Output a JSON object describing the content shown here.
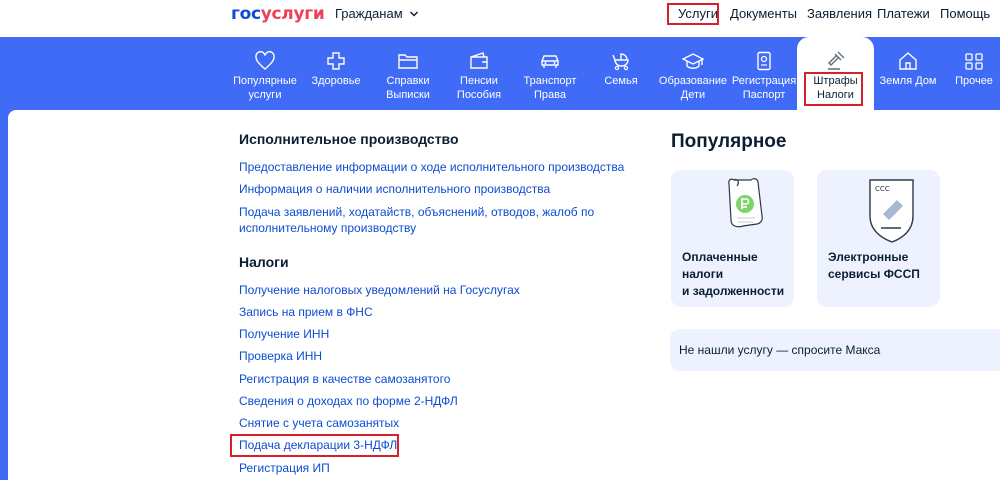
{
  "header": {
    "logo_part1": "гос",
    "logo_part2": "услуги",
    "audience": "Гражданам",
    "nav": [
      "Услуги",
      "Документы",
      "Заявления",
      "Платежи",
      "Помощь"
    ]
  },
  "categories": [
    {
      "line1": "Популярные",
      "line2": "услуги",
      "icon": "heart-icon"
    },
    {
      "line1": "Здоровье",
      "line2": "",
      "icon": "medical-cross-icon"
    },
    {
      "line1": "Справки",
      "line2": "Выписки",
      "icon": "folder-icon"
    },
    {
      "line1": "Пенсии",
      "line2": "Пособия",
      "icon": "wallet-icon"
    },
    {
      "line1": "Транспорт",
      "line2": "Права",
      "icon": "car-icon"
    },
    {
      "line1": "Семья",
      "line2": "",
      "icon": "stroller-icon"
    },
    {
      "line1": "Образование",
      "line2": "Дети",
      "icon": "graduation-cap-icon"
    },
    {
      "line1": "Регистрация",
      "line2": "Паспорт",
      "icon": "passport-icon"
    },
    {
      "line1": "Штрафы",
      "line2": "Налоги",
      "icon": "gavel-icon"
    },
    {
      "line1": "Земля Дом",
      "line2": "",
      "icon": "house-icon"
    },
    {
      "line1": "Прочее",
      "line2": "",
      "icon": "more-icon"
    }
  ],
  "sections": {
    "enforcement": {
      "title": "Исполнительное производство",
      "links": [
        "Предоставление информации о ходе исполнительного производства",
        "Информация о наличии исполнительного производства",
        "Подача заявлений, ходатайств, объяснений, отводов, жалоб по",
        "исполнительному производству"
      ]
    },
    "taxes": {
      "title": "Налоги",
      "links": [
        "Получение налоговых уведомлений на Госуслугах",
        "Запись на прием в ФНС",
        "Получение ИНН",
        "Проверка ИНН",
        "Регистрация в качестве самозанятого",
        "Сведения о доходах по форме 2-НДФЛ",
        "Снятие с учета самозанятых",
        "Подача декларации 3-НДФЛ",
        "Регистрация ИП"
      ]
    }
  },
  "popular": {
    "title": "Популярное",
    "cards": [
      {
        "lines": [
          "Оплаченные",
          "налоги",
          "и задолженности"
        ],
        "icon": "receipt-ruble-icon"
      },
      {
        "lines": [
          "Электронные",
          "сервисы ФССП"
        ],
        "icon": "fssp-emblem-icon"
      }
    ],
    "ask": "Не нашли услугу — спросите Макса"
  },
  "colors": {
    "brand_blue": "#0d4cd3",
    "brand_red": "#ee3f58",
    "category_bar": "#3f6bf6",
    "highlight_box": "#d6202b",
    "card_bg": "#edf2fe"
  }
}
